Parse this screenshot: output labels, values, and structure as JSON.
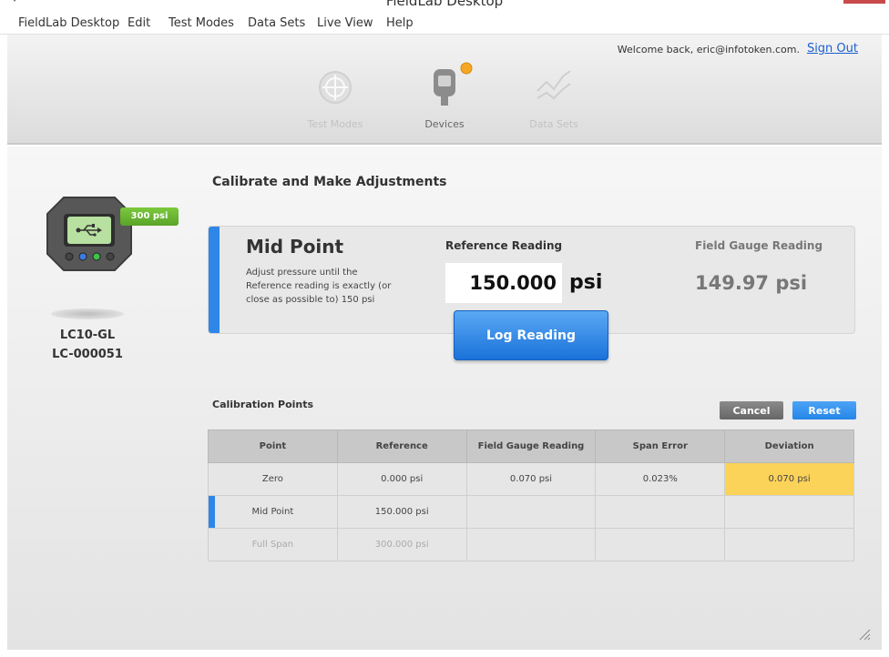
{
  "window": {
    "title": "FieldLab Desktop"
  },
  "menu": [
    "FieldLab Desktop",
    "Edit",
    "Test Modes",
    "Data Sets",
    "Live View",
    "Help"
  ],
  "header": {
    "welcome": "Welcome back, eric@infotoken.com.",
    "sign_out": "Sign Out",
    "nav": [
      {
        "label": "Test Modes",
        "icon": "crosshair-icon",
        "active": false
      },
      {
        "label": "Devices",
        "icon": "device-icon",
        "active": true
      },
      {
        "label": "Data Sets",
        "icon": "line-chart-icon",
        "active": false
      }
    ],
    "notification_color": "#f5a623"
  },
  "device": {
    "badge": "300 psi",
    "model": "LC10-GL",
    "serial": "LC-000051",
    "icon": "usb-icon"
  },
  "calibration": {
    "section_title": "Calibrate and Make Adjustments",
    "step_title": "Mid Point",
    "step_desc": "Adjust pressure until the Reference reading is exactly (or close as possible to) 150 psi",
    "reference_label": "Reference Reading",
    "reference_value": "150.000",
    "reference_unit": "psi",
    "gauge_label": "Field Gauge Reading",
    "gauge_value": "149.97 psi",
    "log_button": "Log Reading"
  },
  "calibration_points": {
    "title": "Calibration Points",
    "cancel": "Cancel",
    "reset": "Reset",
    "columns": [
      "Point",
      "Reference",
      "Field Gauge Reading",
      "Span Error",
      "Deviation"
    ],
    "rows": [
      {
        "point": "Zero",
        "reference": "0.000 psi",
        "gauge": "0.070 psi",
        "span_error": "0.023%",
        "deviation": "0.070 psi"
      },
      {
        "point": "Mid Point",
        "reference": "150.000 psi",
        "gauge": "",
        "span_error": "",
        "deviation": ""
      },
      {
        "point": "Full Span",
        "reference": "300.000 psi",
        "gauge": "",
        "span_error": "",
        "deviation": ""
      }
    ]
  },
  "colors": {
    "accent_blue": "#2e86e8",
    "badge_green": "#6bb832",
    "deviation_warning": "#fcd359"
  }
}
